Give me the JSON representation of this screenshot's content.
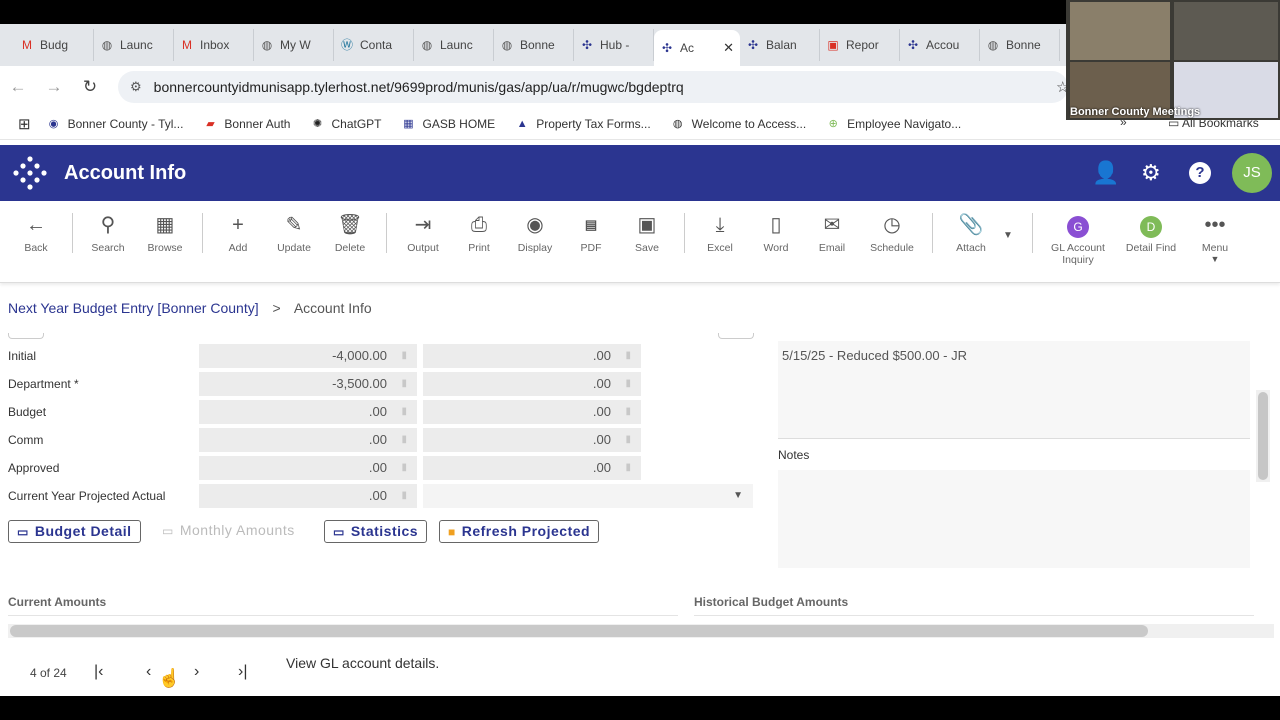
{
  "browser": {
    "tabs": [
      {
        "label": "Budg",
        "icon": "gmail-icon",
        "color": "#d93025"
      },
      {
        "label": "Launc",
        "icon": "globe-icon",
        "color": "#555555"
      },
      {
        "label": "Inbox",
        "icon": "gmail-icon",
        "color": "#d93025"
      },
      {
        "label": "My W",
        "icon": "globe-icon",
        "color": "#555555"
      },
      {
        "label": "Conta",
        "icon": "wordpress-icon",
        "color": "#21759b"
      },
      {
        "label": "Launc",
        "icon": "globe-icon",
        "color": "#555555"
      },
      {
        "label": "Bonne",
        "icon": "globe-icon",
        "color": "#555555"
      },
      {
        "label": "Hub -",
        "icon": "tyler-icon",
        "color": "#2b3590"
      },
      {
        "label": "Ac",
        "icon": "tyler-icon",
        "color": "#2b3590",
        "active": true
      },
      {
        "label": "Balan",
        "icon": "tyler-icon",
        "color": "#2b3590"
      },
      {
        "label": "Repor",
        "icon": "pdf-icon",
        "color": "#d93025"
      },
      {
        "label": "Accou",
        "icon": "tyler-icon",
        "color": "#2b3590"
      },
      {
        "label": "Bonne",
        "icon": "globe-icon",
        "color": "#555555"
      }
    ],
    "url": "bonnercountyidmunisapp.tylerhost.net/9699prod/munis/gas/app/ua/r/mugwc/bgdeptrq",
    "bookmarks": [
      "Bonner County - Tyl...",
      "Bonner Auth",
      "ChatGPT",
      "GASB HOME",
      "Property Tax Forms...",
      "Welcome to Access...",
      "Employee Navigato..."
    ],
    "more_bookmarks": "»",
    "all_bookmarks": "All Bookmarks"
  },
  "video_overlay": {
    "label": "Bonner County Meetings"
  },
  "app": {
    "title": "Account Info",
    "avatar_initials": "JS",
    "brand_color": "#2b3590"
  },
  "toolbar": {
    "back": "Back",
    "search": "Search",
    "browse": "Browse",
    "add": "Add",
    "update": "Update",
    "delete": "Delete",
    "output": "Output",
    "print": "Print",
    "display": "Display",
    "pdf": "PDF",
    "save": "Save",
    "excel": "Excel",
    "word": "Word",
    "email": "Email",
    "schedule": "Schedule",
    "attach": "Attach",
    "gl_inquiry_line1": "GL Account",
    "gl_inquiry_line2": "Inquiry",
    "gl_inquiry_letter": "G",
    "detail_find": "Detail Find",
    "detail_find_letter": "D",
    "menu": "Menu"
  },
  "breadcrumb": {
    "parent": "Next Year Budget Entry [Bonner County]",
    "separator": ">",
    "current": "Account Info"
  },
  "form": {
    "rows": [
      {
        "label": "Initial",
        "amount": "-4,000.00",
        "second": ".00"
      },
      {
        "label": "Department *",
        "amount": "-3,500.00",
        "second": ".00"
      },
      {
        "label": "Budget",
        "amount": ".00",
        "second": ".00"
      },
      {
        "label": "Comm",
        "amount": ".00",
        "second": ".00"
      },
      {
        "label": "Approved",
        "amount": ".00",
        "second": ".00"
      },
      {
        "label": "Current Year Projected Actual",
        "amount": ".00",
        "second": ""
      }
    ],
    "note_text": "5/15/25 - Reduced $500.00 - JR",
    "notes_label": "Notes"
  },
  "buttons": {
    "budget_detail": "Budget Detail",
    "monthly_amounts": "Monthly Amounts",
    "statistics": "Statistics",
    "refresh_projected": "Refresh Projected"
  },
  "sections": {
    "current_amounts": "Current Amounts",
    "historical_budget_amounts": "Historical Budget Amounts"
  },
  "footer": {
    "pager": "4 of 24",
    "status": "View GL account details."
  }
}
